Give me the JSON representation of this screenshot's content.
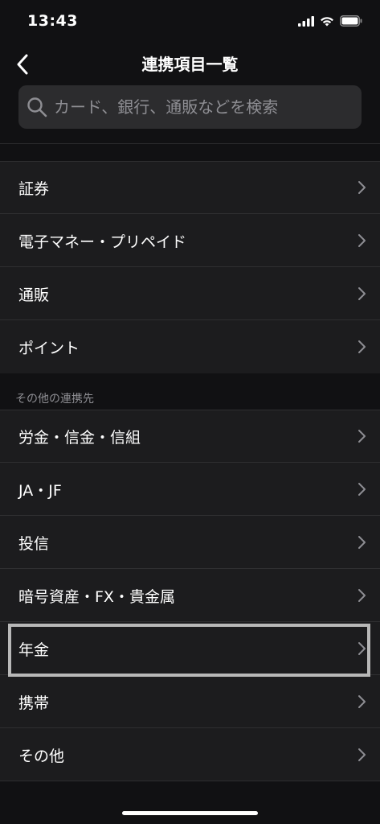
{
  "status_bar": {
    "time": "13:43"
  },
  "nav": {
    "title": "連携項目一覧"
  },
  "search": {
    "placeholder": "カード、銀行、通販などを検索"
  },
  "top_items": [
    {
      "label": "証券"
    },
    {
      "label": "電子マネー・プリペイド"
    },
    {
      "label": "通販"
    },
    {
      "label": "ポイント"
    }
  ],
  "other_section": {
    "header": "その他の連携先"
  },
  "other_items": [
    {
      "label": "労金・信金・信組"
    },
    {
      "label": "JA・JF"
    },
    {
      "label": "投信"
    },
    {
      "label": "暗号資産・FX・貴金属"
    },
    {
      "label": "年金"
    },
    {
      "label": "携帯"
    },
    {
      "label": "その他"
    }
  ],
  "colors": {
    "background": "#111113",
    "row_background": "#1c1c1e",
    "search_background": "#2c2c2e",
    "secondary_text": "#8e8e93",
    "highlight_border": "#b8b8b8"
  }
}
